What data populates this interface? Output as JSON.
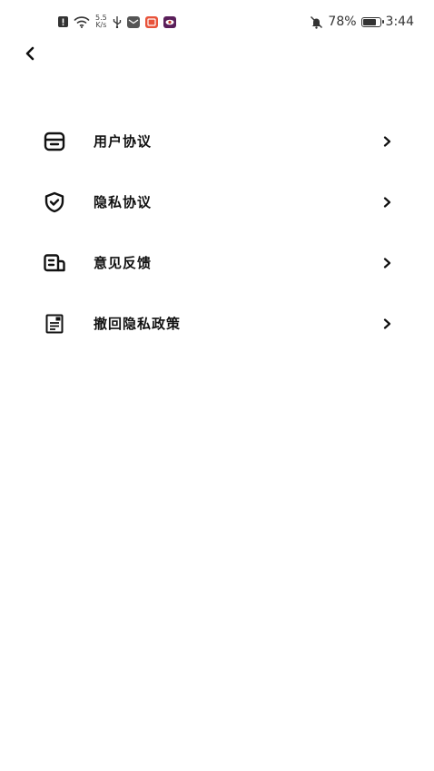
{
  "status_bar": {
    "net_speed_value": "5.5",
    "net_speed_unit": "K/s",
    "battery_text": "78%",
    "battery_level": 0.78,
    "time": "3:44"
  },
  "menu": {
    "items": [
      {
        "label": "用户协议",
        "icon": "inbox-icon"
      },
      {
        "label": "隐私协议",
        "icon": "shield-check-icon"
      },
      {
        "label": "意见反馈",
        "icon": "feedback-icon"
      },
      {
        "label": "撤回隐私政策",
        "icon": "document-icon"
      }
    ]
  }
}
